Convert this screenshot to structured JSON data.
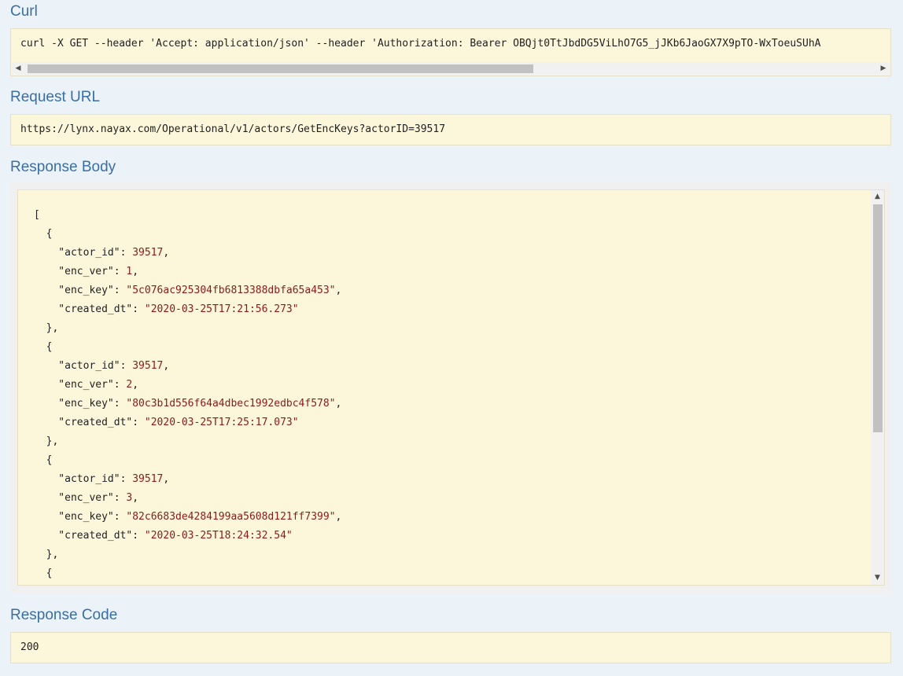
{
  "curl": {
    "title": "Curl",
    "command": "curl -X GET --header 'Accept: application/json' --header 'Authorization: Bearer OBQjt0TtJbdDG5ViLhO7G5_jJKb6JaoGX7X9pTO-WxToeuSUhA"
  },
  "request_url": {
    "title": "Request URL",
    "value": "https://lynx.nayax.com/Operational/v1/actors/GetEncKeys?actorID=39517"
  },
  "response_body": {
    "title": "Response Body",
    "lines": [
      {
        "text": "[",
        "value": ""
      },
      {
        "text": "  {",
        "value": ""
      },
      {
        "text": "    \"actor_id\": ",
        "value": "39517",
        "suffix": ","
      },
      {
        "text": "    \"enc_ver\": ",
        "value": "1",
        "suffix": ","
      },
      {
        "text": "    \"enc_key\": ",
        "value": "\"5c076ac925304fb6813388dbfa65a453\"",
        "suffix": ","
      },
      {
        "text": "    \"created_dt\": ",
        "value": "\"2020-03-25T17:21:56.273\"",
        "suffix": ""
      },
      {
        "text": "  },",
        "value": ""
      },
      {
        "text": "  {",
        "value": ""
      },
      {
        "text": "    \"actor_id\": ",
        "value": "39517",
        "suffix": ","
      },
      {
        "text": "    \"enc_ver\": ",
        "value": "2",
        "suffix": ","
      },
      {
        "text": "    \"enc_key\": ",
        "value": "\"80c3b1d556f64a4dbec1992edbc4f578\"",
        "suffix": ","
      },
      {
        "text": "    \"created_dt\": ",
        "value": "\"2020-03-25T17:25:17.073\"",
        "suffix": ""
      },
      {
        "text": "  },",
        "value": ""
      },
      {
        "text": "  {",
        "value": ""
      },
      {
        "text": "    \"actor_id\": ",
        "value": "39517",
        "suffix": ","
      },
      {
        "text": "    \"enc_ver\": ",
        "value": "3",
        "suffix": ","
      },
      {
        "text": "    \"enc_key\": ",
        "value": "\"82c6683de4284199aa5608d121ff7399\"",
        "suffix": ","
      },
      {
        "text": "    \"created_dt\": ",
        "value": "\"2020-03-25T18:24:32.54\"",
        "suffix": ""
      },
      {
        "text": "  },",
        "value": ""
      },
      {
        "text": "  {",
        "value": ""
      }
    ]
  },
  "response_code": {
    "title": "Response Code",
    "value": "200"
  },
  "colors": {
    "title": "#3a6ea5",
    "box_bg": "#fcf6db",
    "json_value": "#8b1a1a"
  }
}
